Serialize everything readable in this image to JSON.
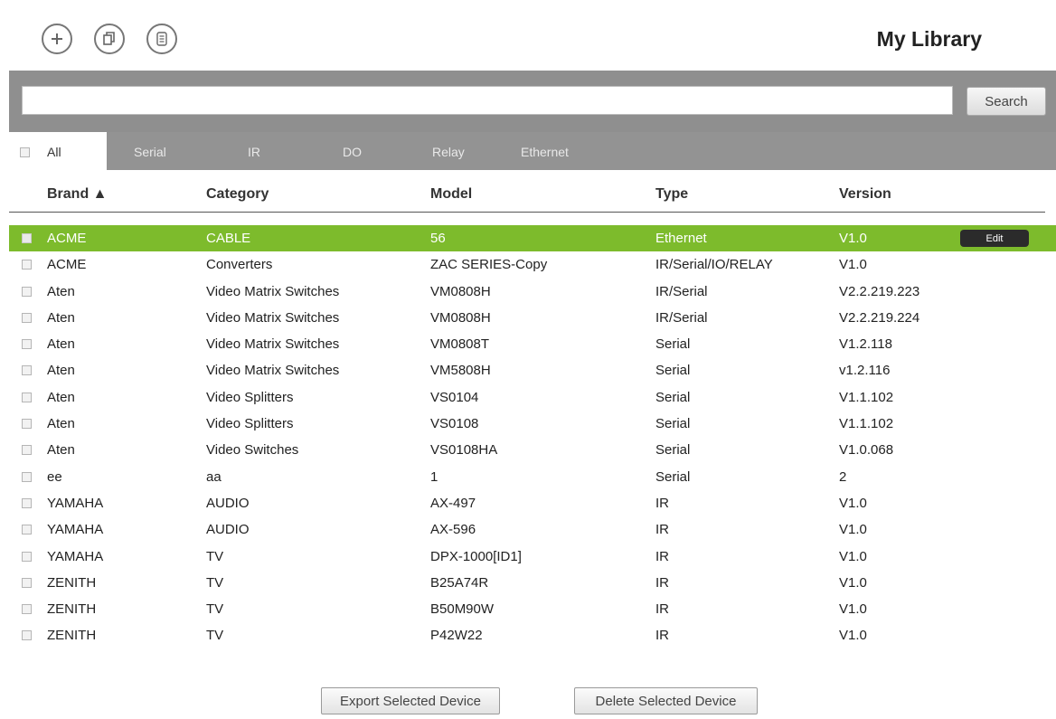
{
  "header": {
    "title": "My Library",
    "icons": [
      "add-icon",
      "copy-icon",
      "list-icon"
    ]
  },
  "search": {
    "placeholder": "",
    "value": "",
    "button_label": "Search"
  },
  "tabs": {
    "all": "All",
    "items": [
      "Serial",
      "IR",
      "DO",
      "Relay",
      "Ethernet"
    ]
  },
  "table": {
    "columns": {
      "brand": "Brand ▲",
      "category": "Category",
      "model": "Model",
      "type": "Type",
      "version": "Version"
    },
    "selected_row_color": "#7dbb2c",
    "edit_label": "Edit",
    "rows": [
      {
        "brand": "ACME",
        "category": "CABLE",
        "model": "56",
        "type": "Ethernet",
        "version": "V1.0",
        "selected": true
      },
      {
        "brand": "ACME",
        "category": "Converters",
        "model": "ZAC SERIES-Copy",
        "type": "IR/Serial/IO/RELAY",
        "version": "V1.0"
      },
      {
        "brand": "Aten",
        "category": "Video Matrix Switches",
        "model": "VM0808H",
        "type": "IR/Serial",
        "version": "V2.2.219.223"
      },
      {
        "brand": "Aten",
        "category": "Video Matrix Switches",
        "model": "VM0808H",
        "type": "IR/Serial",
        "version": "V2.2.219.224"
      },
      {
        "brand": "Aten",
        "category": "Video Matrix Switches",
        "model": "VM0808T",
        "type": "Serial",
        "version": "V1.2.118"
      },
      {
        "brand": "Aten",
        "category": "Video Matrix Switches",
        "model": "VM5808H",
        "type": "Serial",
        "version": "v1.2.116"
      },
      {
        "brand": "Aten",
        "category": "Video Splitters",
        "model": "VS0104",
        "type": "Serial",
        "version": "V1.1.102"
      },
      {
        "brand": "Aten",
        "category": "Video Splitters",
        "model": "VS0108",
        "type": "Serial",
        "version": "V1.1.102"
      },
      {
        "brand": "Aten",
        "category": "Video Switches",
        "model": "VS0108HA",
        "type": "Serial",
        "version": "V1.0.068"
      },
      {
        "brand": "ee",
        "category": "aa",
        "model": "1",
        "type": "Serial",
        "version": "2"
      },
      {
        "brand": "YAMAHA",
        "category": "AUDIO",
        "model": "AX-497",
        "type": "IR",
        "version": "V1.0"
      },
      {
        "brand": "YAMAHA",
        "category": "AUDIO",
        "model": "AX-596",
        "type": "IR",
        "version": "V1.0"
      },
      {
        "brand": "YAMAHA",
        "category": "TV",
        "model": "DPX-1000[ID1]",
        "type": "IR",
        "version": "V1.0"
      },
      {
        "brand": "ZENITH",
        "category": "TV",
        "model": "B25A74R",
        "type": "IR",
        "version": "V1.0"
      },
      {
        "brand": "ZENITH",
        "category": "TV",
        "model": "B50M90W",
        "type": "IR",
        "version": "V1.0"
      },
      {
        "brand": "ZENITH",
        "category": "TV",
        "model": "P42W22",
        "type": "IR",
        "version": "V1.0"
      }
    ]
  },
  "footer": {
    "export_label": "Export Selected Device",
    "delete_label": "Delete Selected Device"
  }
}
